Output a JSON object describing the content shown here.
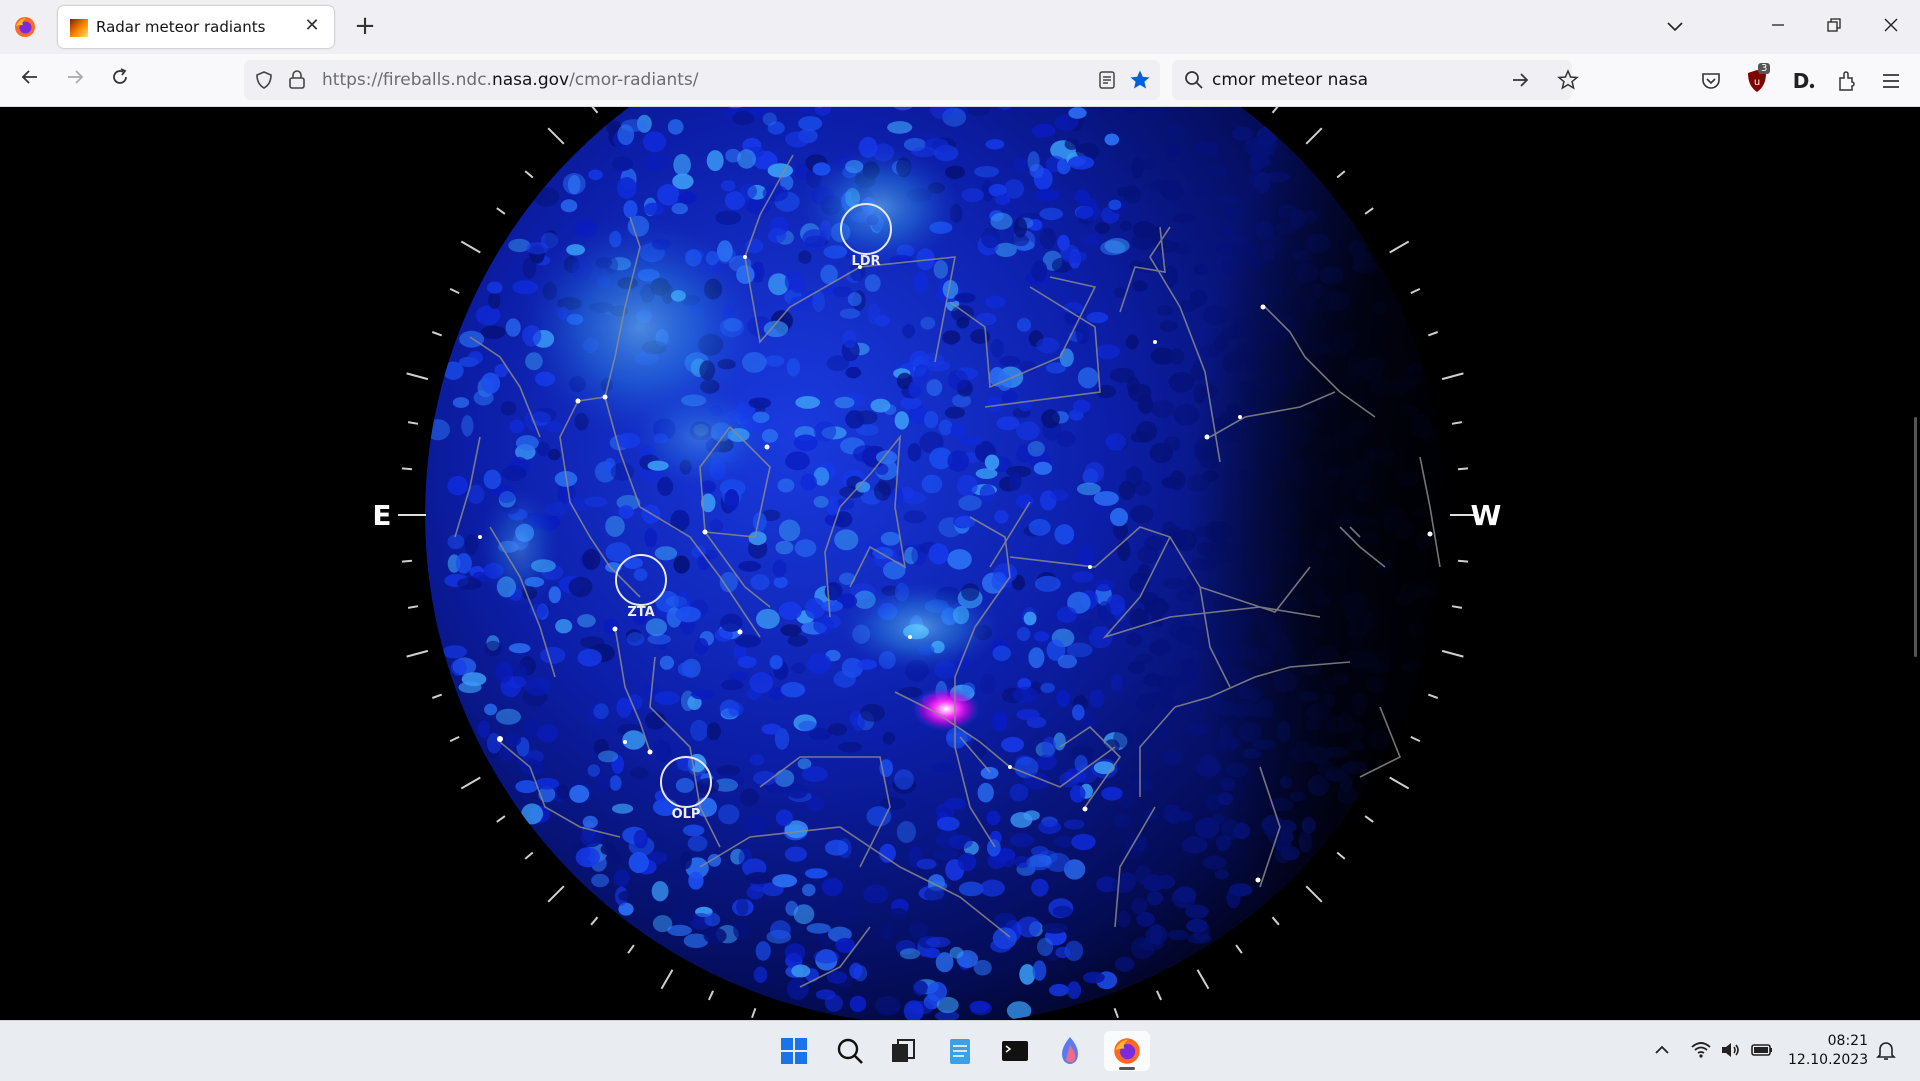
{
  "browser": {
    "tab_title": "Radar meteor radiants",
    "new_tab_label": "+",
    "url_prefix": "https://fireballs.ndc.",
    "url_domain": "nasa.gov",
    "url_path": "/cmor-radiants/",
    "search_query": "cmor meteor nasa",
    "ublock_badge": "3"
  },
  "sky_map": {
    "direction_east": "E",
    "direction_west": "W",
    "showers": [
      {
        "code": "LDR"
      },
      {
        "code": "ZTA"
      },
      {
        "code": "OLP"
      }
    ]
  },
  "taskbar": {
    "time": "08:21",
    "date": "12.10.2023"
  },
  "colors": {
    "tab_strip_bg": "#f0f0f4",
    "accent_blue": "#0061e0",
    "density_low": "#0a1fb0",
    "density_mid": "#3ba8f5",
    "density_peak": "#ff00ff"
  },
  "icons": [
    "firefox-icon",
    "reader-icon",
    "bookmark-star-icon",
    "search-icon",
    "arrow-right-icon",
    "pocket-icon",
    "ublock-icon",
    "extensions-icon",
    "menu-icon",
    "windows-start-icon",
    "taskbar-search-icon",
    "task-view-icon",
    "notepad-icon",
    "terminal-icon",
    "app-icon",
    "wifi-icon",
    "volume-icon",
    "battery-icon",
    "bell-icon"
  ]
}
